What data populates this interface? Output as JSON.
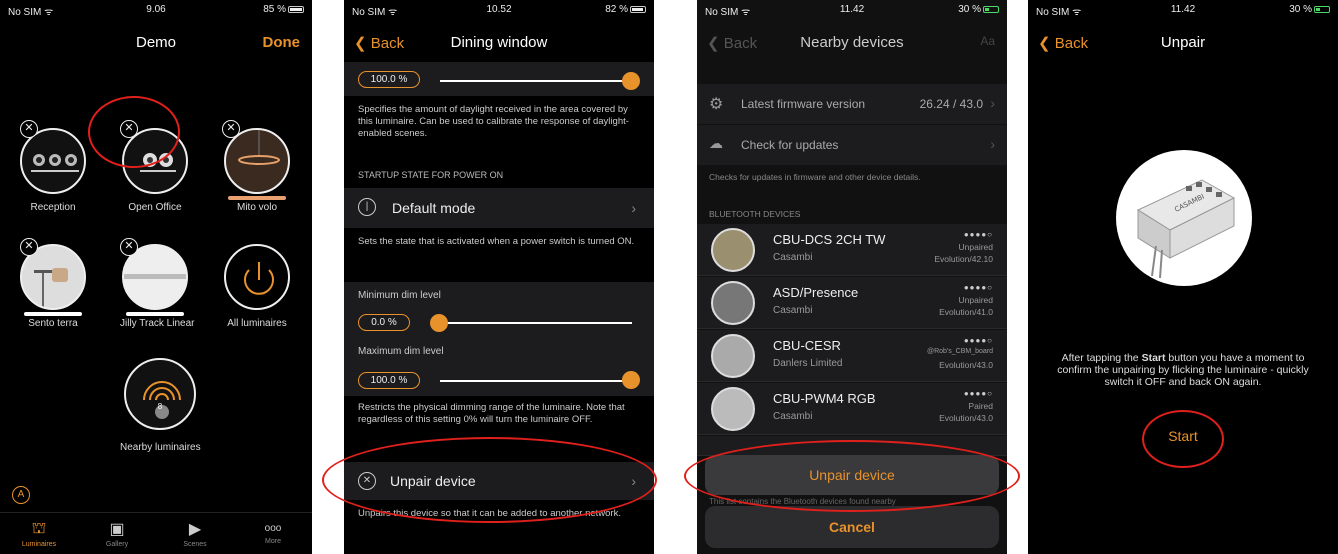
{
  "p1": {
    "status": {
      "carrier": "No SIM ᯤ",
      "time": "9.06",
      "battery": "85 %"
    },
    "title": "Demo",
    "done": "Done",
    "tiles": [
      {
        "label": "Reception"
      },
      {
        "label": "Open Office"
      },
      {
        "label": "Mito volo"
      },
      {
        "label": "Sento terra"
      },
      {
        "label": "Jilly Track Linear"
      },
      {
        "label": "All luminaires"
      },
      {
        "label": "Nearby luminaires",
        "badge": "8"
      }
    ],
    "tabs": [
      {
        "label": "Luminaires",
        "icon": "luminaire-icon"
      },
      {
        "label": "Gallery",
        "icon": "gallery-icon"
      },
      {
        "label": "Scenes",
        "icon": "scenes-icon"
      },
      {
        "label": "More",
        "icon": "more-icon"
      }
    ],
    "more_glyph": "ooo"
  },
  "p2": {
    "status": {
      "carrier": "No SIM ᯤ",
      "time": "10.52",
      "battery": "82 %"
    },
    "back": "Back",
    "title": "Dining window",
    "daylight_value": "100.0 %",
    "daylight_desc": "Specifies the amount of daylight received in the area covered by this luminaire. Can be used to calibrate the response of daylight-enabled scenes.",
    "startup_header": "STARTUP STATE FOR POWER ON",
    "default_mode": "Default mode",
    "default_desc": "Sets the state that is activated when a power switch is turned ON.",
    "min_label": "Minimum dim level",
    "min_value": "0.0 %",
    "max_label": "Maximum dim level",
    "max_value": "100.0 %",
    "range_desc": "Restricts the physical dimming range of the luminaire. Note that regardless of this setting 0% will turn the luminaire OFF.",
    "unpair": "Unpair device",
    "unpair_desc": "Unpairs this device so that it can be added to another network."
  },
  "p3": {
    "status": {
      "carrier": "No SIM ᯤ",
      "time": "11.42",
      "battery": "30 %"
    },
    "back": "Back",
    "title": "Nearby devices",
    "right": "Aa",
    "fw_label": "Latest firmware version",
    "fw_value": "26.24 / 43.0",
    "check": "Check for updates",
    "check_desc": "Checks for updates in firmware and other device details.",
    "bt_header": "BLUETOOTH DEVICES",
    "devices": [
      {
        "name": "CBU-DCS 2CH TW",
        "maker": "Casambi",
        "status": "Unpaired",
        "fw": "Evolution/42.10",
        "signal": "●●●●○"
      },
      {
        "name": "ASD/Presence",
        "maker": "Casambi",
        "status": "Unpaired",
        "fw": "Evolution/41.0",
        "signal": "●●●●○"
      },
      {
        "name": "CBU-CESR",
        "maker": "Danlers Limited",
        "status": "@Rob's_CBM_board",
        "fw": "Evolution/43.0",
        "signal": "●●●●○"
      },
      {
        "name": "CBU-PWM4 RGB",
        "maker": "Casambi",
        "status": "Paired",
        "fw": "Evolution/43.0",
        "signal": "●●●●○"
      }
    ],
    "footer_text": "This list contains the Bluetooth devices found nearby",
    "sheet_action": "Unpair device",
    "sheet_cancel": "Cancel"
  },
  "p4": {
    "status": {
      "carrier": "No SIM ᯤ",
      "time": "11.42",
      "battery": "30 %"
    },
    "back": "Back",
    "title": "Unpair",
    "device_brand": "CASAMBI",
    "instr_1": "After tapping the ",
    "instr_bold": "Start",
    "instr_2": " button you have a moment to confirm the unpairing by flicking the luminaire - quickly switch it OFF and back ON again.",
    "start": "Start"
  },
  "colors": {
    "accent": "#e8922c",
    "highlight_circle": "#e0201c"
  }
}
